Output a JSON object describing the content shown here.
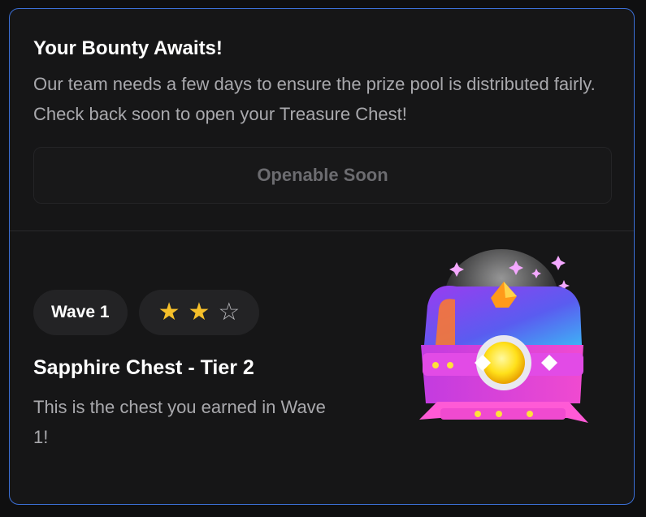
{
  "bounty": {
    "title": "Your Bounty Awaits!",
    "description": "Our team needs a few days to ensure the prize pool is distributed fairly. Check back soon to open your Treasure Chest!",
    "button_label": "Openable Soon"
  },
  "chest": {
    "wave_label": "Wave 1",
    "rating": {
      "filled": 2,
      "total": 3
    },
    "name": "Sapphire Chest - Tier 2",
    "description": "This is the chest you earned in Wave 1!"
  },
  "colors": {
    "accent_border": "#3b6fd6",
    "star_filled": "#f5bf2a",
    "star_empty": "#b7b7bb"
  }
}
